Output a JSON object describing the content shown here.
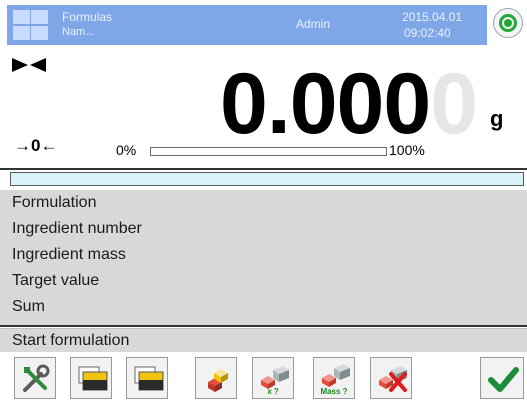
{
  "header": {
    "title": "Formulas",
    "subtitle": "Nam...",
    "user": "Admin",
    "date": "2015.04.01",
    "time": "09:02:40"
  },
  "display": {
    "weight_main": "0.000",
    "weight_last_digit": "0",
    "unit": "g",
    "zero_indicator": "→0←",
    "bargraph_min": "0%",
    "bargraph_max": "100%",
    "bargraph_level": 0
  },
  "info": {
    "rows": [
      "Formulation",
      "Ingredient number",
      "Ingredient mass",
      "Target value",
      "Sum"
    ]
  },
  "start_label": "Start formulation",
  "toolbar": {
    "buttons": [
      {
        "icon": "settings-tools-icon",
        "tag": ""
      },
      {
        "icon": "database-card-icon",
        "tag": ""
      },
      {
        "icon": "database-card-icon",
        "tag": ""
      },
      {
        "icon": "ingredients-icon",
        "tag": ""
      },
      {
        "icon": "formula-check-icon",
        "tag": "x ?"
      },
      {
        "icon": "formula-mass-icon",
        "tag": "Mass ?"
      },
      {
        "icon": "formula-cancel-icon",
        "tag": ""
      }
    ],
    "confirm_icon": "checkmark-icon"
  },
  "colors": {
    "header_bar": "#7fa7e8",
    "status_green": "#23a838",
    "info_bg": "#d8d8d8",
    "progress_bg": "#d8f4f9",
    "ok_green": "#1d8b3a"
  }
}
